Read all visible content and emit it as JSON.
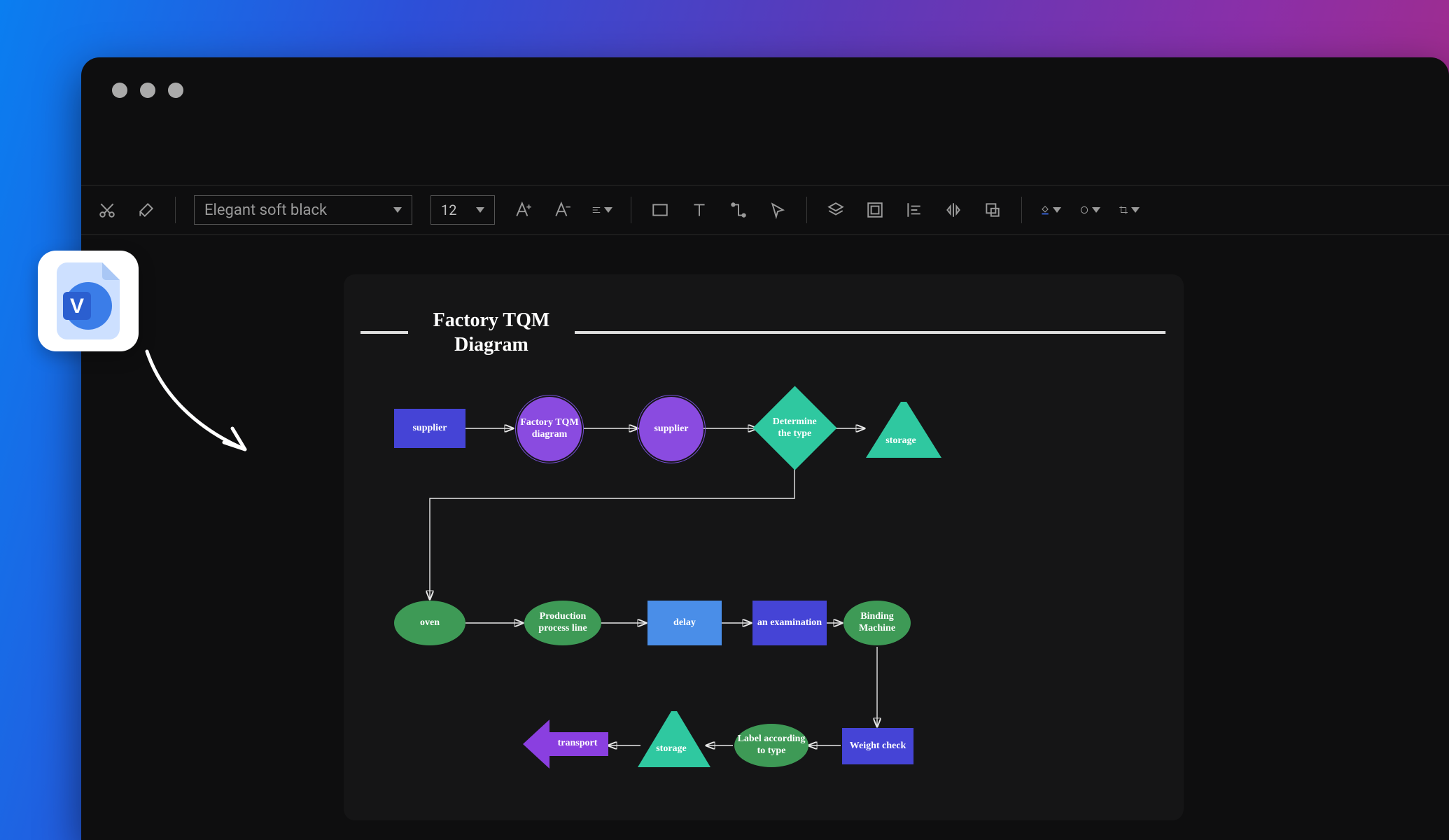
{
  "toolbar": {
    "font_name": "Elegant soft black",
    "font_size": "12"
  },
  "diagram": {
    "title": "Factory TQM Diagram",
    "nodes": {
      "supplier1": "supplier",
      "factory_tqm": "Factory TQM diagram",
      "supplier2": "supplier",
      "determine": "Determine the type",
      "storage1": "storage",
      "oven": "oven",
      "production": "Production process line",
      "delay": "delay",
      "examination": "an examination",
      "binding": "Binding Machine",
      "weight": "Weight check",
      "label": "Label according to type",
      "storage2": "storage",
      "transport": "transport"
    }
  },
  "badge": {
    "letter": "V"
  },
  "colors": {
    "blue": "#4544d6",
    "purple": "#8a4be0",
    "teal": "#2fc8a0",
    "green": "#3e9a56",
    "lightblue": "#4a8ee8",
    "purple_arrow": "#8a3fe0"
  }
}
